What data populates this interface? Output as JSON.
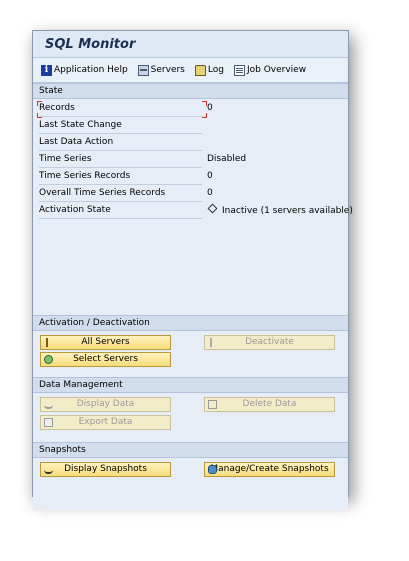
{
  "window": {
    "title": "SQL Monitor"
  },
  "toolbar": {
    "application_help": "Application Help",
    "servers": "Servers",
    "log": "Log",
    "job_overview": "Job Overview"
  },
  "state": {
    "heading": "State",
    "rows": [
      {
        "label": "Records",
        "value": "0"
      },
      {
        "label": "Last State Change",
        "value": ""
      },
      {
        "label": "Last Data Action",
        "value": ""
      },
      {
        "label": "Time Series",
        "value": "Disabled"
      },
      {
        "label": "Time Series Records",
        "value": "0"
      },
      {
        "label": "Overall Time Series Records",
        "value": "0"
      },
      {
        "label": "Activation State",
        "value": "Inactive (1 servers available)"
      }
    ]
  },
  "activation": {
    "heading": "Activation / Deactivation",
    "all_servers": "All Servers",
    "deactivate": "Deactivate",
    "select_servers": "Select Servers"
  },
  "data_management": {
    "heading": "Data Management",
    "display_data": "Display Data",
    "delete_data": "Delete Data",
    "export_data": "Export Data"
  },
  "snapshots": {
    "heading": "Snapshots",
    "display_snapshots": "Display Snapshots",
    "manage_snapshots": "Manage/Create Snapshots"
  }
}
